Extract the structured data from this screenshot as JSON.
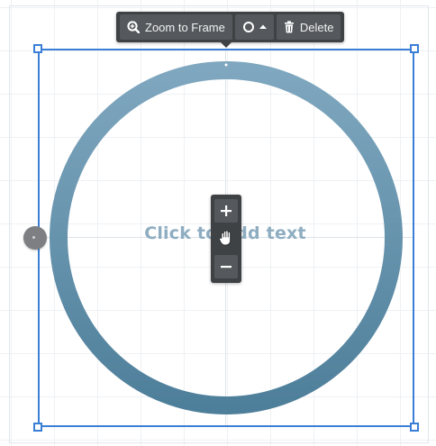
{
  "canvas": {
    "placeholder_text": "Click to add text",
    "ring_color_top": "#7fa7bf",
    "ring_color_bottom": "#4e7f9a",
    "selection_color": "#3a7fd5"
  },
  "toolbar": {
    "zoom_to_frame_label": "Zoom to Frame",
    "zoom_to_frame_icon": "zoom-icon",
    "frame_shape_icon": "circle-icon",
    "frame_shape_dropdown_icon": "caret-up-icon",
    "delete_label": "Delete",
    "delete_icon": "trash-icon"
  },
  "zoom_controls": {
    "plus_label": "+",
    "minus_label": "−",
    "pan_icon": "hand-grab-icon"
  }
}
